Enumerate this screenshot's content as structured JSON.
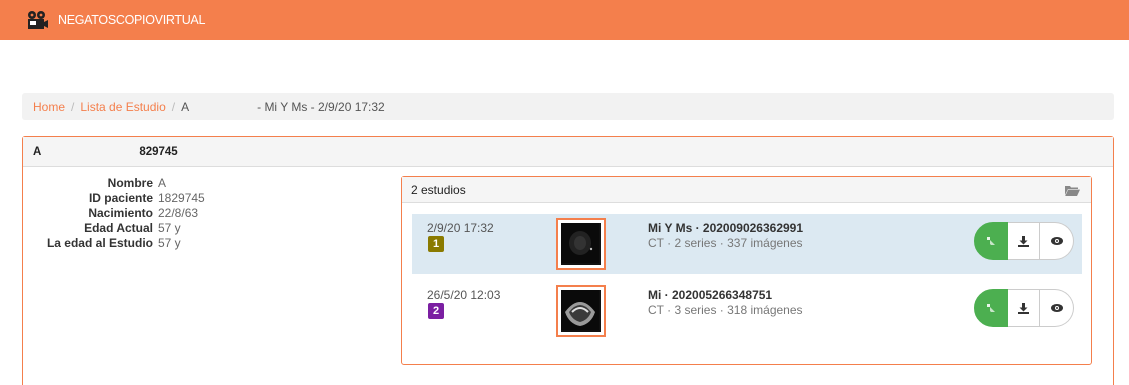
{
  "app": {
    "title": "NEGATOSCOPIOVIRTUAL"
  },
  "breadcrumb": {
    "home": "Home",
    "list": "Lista de Estudio",
    "current": "A",
    "extra": "- Mi Y Ms - 2/9/20 17:32"
  },
  "patient": {
    "name_header": "A",
    "id_header": "829745",
    "fields": [
      {
        "label": "Nombre",
        "value": "A"
      },
      {
        "label": "ID paciente",
        "value": "1829745"
      },
      {
        "label": "Nacimiento",
        "value": "22/8/63"
      },
      {
        "label": "Edad Actual",
        "value": "57 y"
      },
      {
        "label": "La edad al Estudio",
        "value": "57 y"
      }
    ]
  },
  "studies": {
    "header": "2 estudios",
    "items": [
      {
        "date": "2/9/20 17:32",
        "index": "1",
        "desc": "Mi Y Ms · 202009026362991",
        "meta": "CT · 2 series · 337 imágenes",
        "badge_color": "#8a7a00"
      },
      {
        "date": "26/5/20 12:03",
        "index": "2",
        "desc": "Mi · 202005266348751",
        "meta": "CT · 3 series · 318 imágenes",
        "badge_color": "#7b1fa2"
      }
    ]
  },
  "colors": {
    "accent": "#f47f4c",
    "selected_row": "#dce9f2",
    "view_button": "#4caf50"
  },
  "icons": [
    "film-projector-icon",
    "folder-open-icon",
    "viewer-icon",
    "download-icon",
    "eye-icon"
  ]
}
